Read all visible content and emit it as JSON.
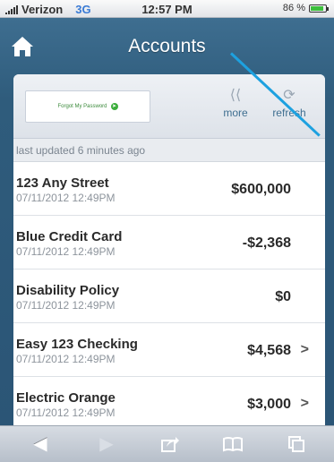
{
  "status_bar": {
    "carrier": "Verizon",
    "network": "3G",
    "time": "12:57 PM",
    "battery_percent": "86 %",
    "battery_level": 0.86
  },
  "header": {
    "title": "Accounts",
    "home_icon": "home-icon"
  },
  "panel": {
    "forgot_password": "Forgot My Password",
    "more_label": "more",
    "refresh_label": "refresh",
    "last_updated": "last updated 6 minutes ago"
  },
  "accounts": [
    {
      "name": "123 Any Street",
      "date": "07/11/2012 12:49PM",
      "amount": "$600,000",
      "chevron": ""
    },
    {
      "name": "Blue Credit Card",
      "date": "07/11/2012 12:49PM",
      "amount": "-$2,368",
      "chevron": ""
    },
    {
      "name": "Disability Policy",
      "date": "07/11/2012 12:49PM",
      "amount": "$0",
      "chevron": ""
    },
    {
      "name": "Easy 123 Checking",
      "date": "07/11/2012 12:49PM",
      "amount": "$4,568",
      "chevron": ">"
    },
    {
      "name": "Electric Orange",
      "date": "07/11/2012 12:49PM",
      "amount": "$3,000",
      "chevron": ">"
    }
  ],
  "toolbar": {
    "back_icon": "back-arrow-icon",
    "forward_icon": "forward-arrow-icon",
    "share_icon": "share-icon",
    "bookmarks_icon": "bookmarks-icon",
    "tabs_icon": "tabs-icon"
  },
  "colors": {
    "nav_background": "#2f5c7c",
    "accent": "#3e6e90",
    "pointer_line": "#1da1e0"
  }
}
